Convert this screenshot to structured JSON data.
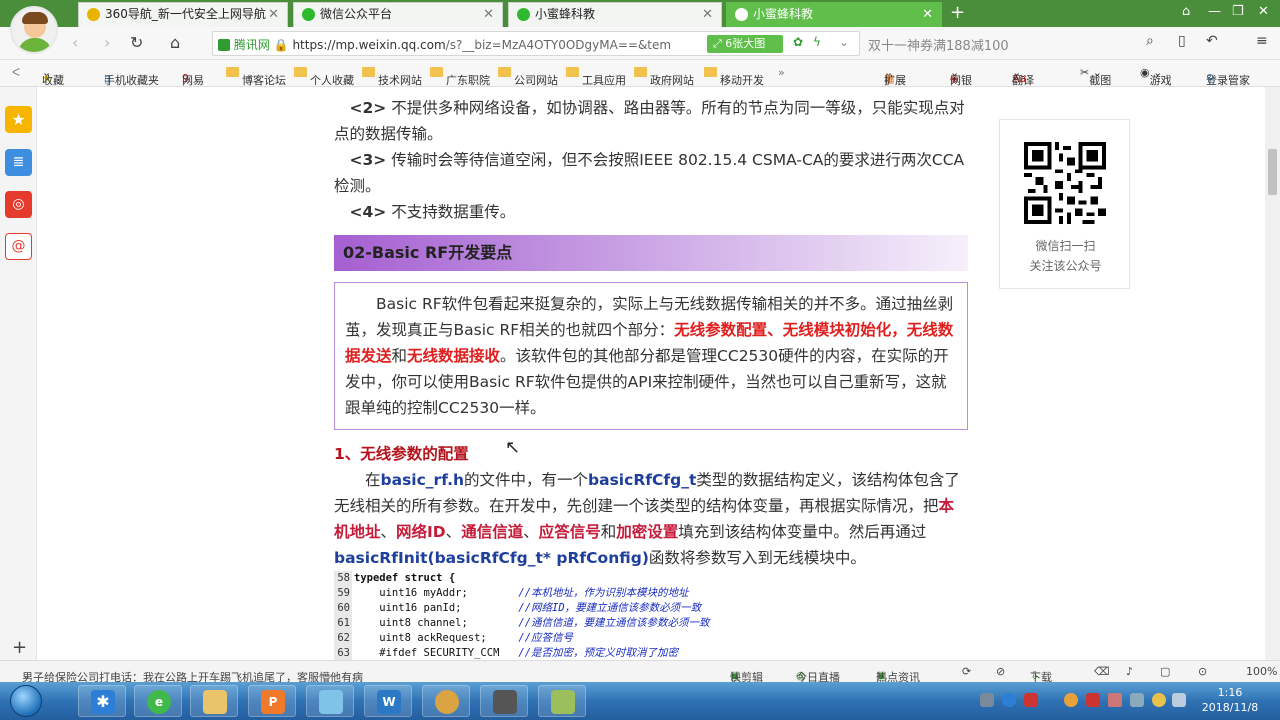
{
  "tabs": [
    {
      "label": "360导航_新一代安全上网导航",
      "color": "#e8b400"
    },
    {
      "label": "微信公众平台",
      "color": "#2dbb2d"
    },
    {
      "label": "小蜜蜂科教",
      "color": "#2dbb2d"
    },
    {
      "label": "小蜜蜂科教",
      "color": "#2dbb2d",
      "active": true
    }
  ],
  "address": {
    "site_badge": "腾讯网",
    "url_host": "https://mp.weixin.qq.com",
    "url_path": "/s?__biz=MzA4OTY0ODgyMA==&tem",
    "big_image": "6张大图",
    "search_placeholder": "双十一神券满188减100"
  },
  "bookmarks": [
    "收藏",
    "手机收藏夹",
    "网易",
    "博客论坛",
    "个人收藏",
    "技术网站",
    "广东职院",
    "公司网站",
    "工具应用",
    "政府网站",
    "移动开发",
    "扩展",
    "网银",
    "翻译",
    "截图",
    "游戏",
    "登录管家"
  ],
  "article": {
    "p2_num": "<2>",
    "p2_text": "不提供多种网络设备，如协调器、路由器等。所有的节点为同一等级，只能实现点对点的数据传输。",
    "p3_num": "<3>",
    "p3_text": "传输时会等待信道空闲，但不会按照IEEE 802.15.4 CSMA-CA的要求进行两次CCA检测。",
    "p4_num": "<4>",
    "p4_text": "不支持数据重传。",
    "section_header": "02-Basic RF开发要点",
    "box_a": "Basic RF软件包看起来挺复杂的，实际上与无线数据传输相关的并不多。通过抽丝剥茧，发现真正与Basic RF相关的也就四个部分：",
    "box_r1": "无线参数配置",
    "box_sep1": "、",
    "box_r2": "无线模块初始化",
    "box_sep2": "，",
    "box_r3": "无线数据发送",
    "box_and": "和",
    "box_r4": "无线数据接收",
    "box_b": "。该软件包的其他部分都是管理CC2530硬件的内容，在实际的开发中，你可以使用Basic RF软件包提供的API来控制硬件，当然也可以自己重新写，这就跟单纯的控制CC2530一样。",
    "h1": "1、无线参数的配置",
    "q_a": "在",
    "q_f": "basic_rf.h",
    "q_b": "的文件中，有一个",
    "q_t": "basicRfCfg_t",
    "q_c": "类型的数据结构定义，该结构体包含了无线相关的所有参数。在开发中，先创建一个该类型的结构体变量，再根据实际情况，把",
    "q_k1": "本机地址",
    "q_s1": "、",
    "q_k2": "网络ID",
    "q_s2": "、",
    "q_k3": "通信信道",
    "q_s3": "、",
    "q_k4": "应答信号",
    "q_and": "和",
    "q_k5": "加密设置",
    "q_d": "填充到该结构体变量中。然后再通过",
    "q_fn": "basicRfInit(basicRfCfg_t* pRfConfig)",
    "q_e": "函数将参数写入到无线模块中。"
  },
  "code": [
    {
      "n": "58",
      "c": "typedef struct {",
      "cm": ""
    },
    {
      "n": "59",
      "c": "    uint16 myAddr;        ",
      "cm": "//本机地址，作为识别本模块的地址"
    },
    {
      "n": "60",
      "c": "    uint16 panId;         ",
      "cm": "//网络ID，要建立通信该参数必须一致"
    },
    {
      "n": "61",
      "c": "    uint8 channel;        ",
      "cm": "//通信信道，要建立通信该参数必须一致"
    },
    {
      "n": "62",
      "c": "    uint8 ackRequest;     ",
      "cm": "//应答信号"
    },
    {
      "n": "63",
      "c": "    #ifdef SECURITY_CCM   ",
      "cm": "//是否加密，预定义时取消了加密"
    }
  ],
  "qr": {
    "cap1": "微信扫一扫",
    "cap2": "关注该公众号"
  },
  "status": {
    "news": "男子给保险公司打电话：我在公路上开车踢飞机追尾了，客服懵他有病",
    "items": [
      "快剪辑",
      "今日直播",
      "热点资讯",
      "下载",
      "100%"
    ]
  },
  "clock": {
    "time": "1:16",
    "date": "2018/11/8"
  }
}
